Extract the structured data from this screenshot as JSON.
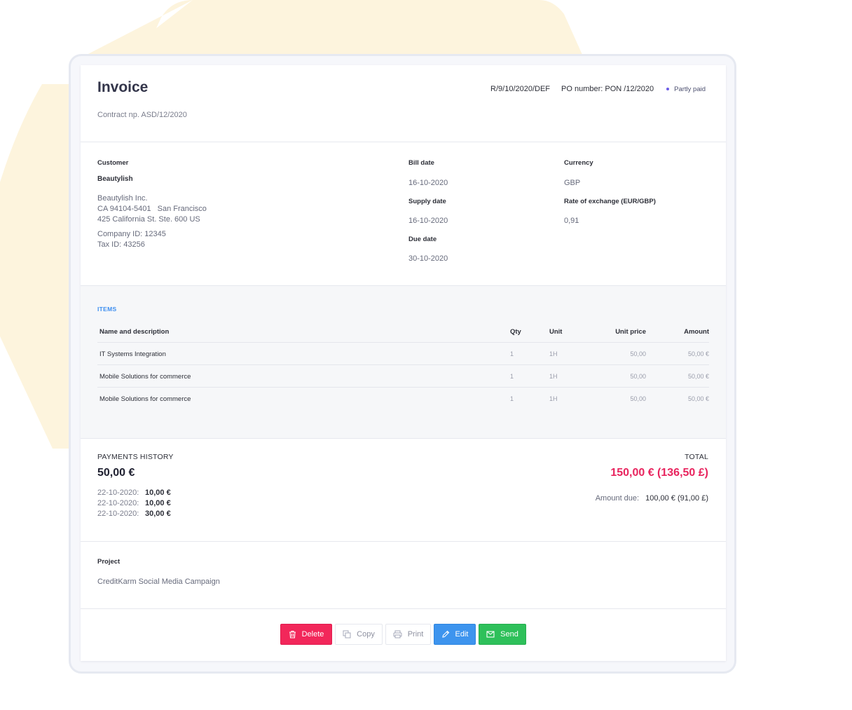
{
  "header": {
    "title": "Invoice",
    "contract": "Contract np. ASD/12/2020",
    "reference": "R/9/10/2020/DEF",
    "po_number": "PO number: PON /12/2020",
    "status": "Partly paid"
  },
  "customer": {
    "label": "Customer",
    "name": "Beautylish",
    "company": "Beautylish Inc.",
    "address_line1": "CA 94104-5401   San Francisco",
    "address_line2": "425 California St. Ste. 600 US",
    "company_id": "Company ID: 12345",
    "tax_id": "Tax ID: 43256"
  },
  "dates": {
    "bill_label": "Bill date",
    "bill_value": "16-10-2020",
    "supply_label": "Supply date",
    "supply_value": "16-10-2020",
    "due_label": "Due date",
    "due_value": "30-10-2020"
  },
  "currency": {
    "label": "Currency",
    "value": "GBP",
    "rate_label": "Rate of exchange (EUR/GBP)",
    "rate_value": "0,91"
  },
  "items": {
    "title": "ITEMS",
    "columns": [
      "Name and description",
      "Qty",
      "Unit",
      "Unit price",
      "Amount"
    ],
    "rows": [
      [
        "IT Systems Integration",
        "1",
        "1H",
        "50,00",
        "50,00 €"
      ],
      [
        "Mobile Solutions for commerce",
        "1",
        "1H",
        "50,00",
        "50,00 €"
      ],
      [
        "Mobile Solutions for commerce",
        "1",
        "1H",
        "50,00",
        "50,00 €"
      ]
    ]
  },
  "payments": {
    "title": "PAYMENTS HISTORY",
    "total_paid": "50,00 €",
    "entries": [
      {
        "date": "22-10-2020:",
        "amount": "10,00 €"
      },
      {
        "date": "22-10-2020:",
        "amount": "10,00 €"
      },
      {
        "date": "22-10-2020:",
        "amount": "30,00 €"
      }
    ]
  },
  "total": {
    "title": "TOTAL",
    "amount": "150,00 € (136,50 £)",
    "due_label": "Amount due:",
    "due_value": "100,00 € (91,00 £)"
  },
  "project": {
    "label": "Project",
    "value": "CreditKarm Social Media Campaign"
  },
  "actions": {
    "delete": "Delete",
    "copy": "Copy",
    "print": "Print",
    "edit": "Edit",
    "send": "Send"
  },
  "colors": {
    "accent_blue": "#3d8ef0",
    "total_pink": "#e8245e",
    "status_dot": "#6c5ce7",
    "delete_red": "#f2275a",
    "edit_blue": "#3d94ee",
    "send_green": "#2ec05a",
    "background_shape": "#fdf4dd"
  }
}
